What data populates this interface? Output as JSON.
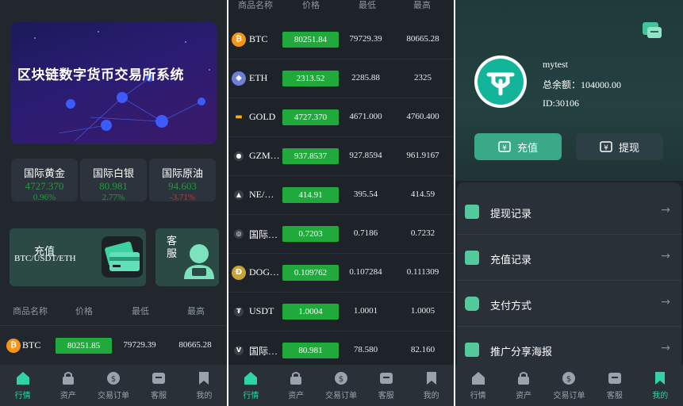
{
  "home": {
    "banner_title": "区块链数字货币交易所系统",
    "tickers": [
      {
        "name": "国际黄金",
        "value": "4727.370",
        "change": "0.96%"
      },
      {
        "name": "国际白银",
        "value": "80.981",
        "change": "2.77%"
      },
      {
        "name": "国际原油",
        "value": "94.603",
        "change": "-3.71%"
      }
    ],
    "recharge_title": "充值",
    "recharge_sub": "BTC/USDT/ETH",
    "service_label": "客服",
    "list_headers": [
      "商品名称",
      "价格",
      "最低",
      "最高"
    ],
    "first_row": {
      "icon": "bitcoin-icon",
      "name": "BTC",
      "price": "80251.85",
      "low": "79729.39",
      "high": "80665.28"
    }
  },
  "market": {
    "headers": [
      "商品名称",
      "价格",
      "最低",
      "最高"
    ],
    "rows": [
      {
        "icon": "bitcoin-icon",
        "name": "BTC",
        "price": "80251.84",
        "low": "79729.39",
        "high": "80665.28"
      },
      {
        "icon": "ethereum-icon",
        "name": "ETH",
        "price": "2313.52",
        "low": "2285.88",
        "high": "2325"
      },
      {
        "icon": "gold-bars-icon",
        "name": "GOLD",
        "price": "4727.370",
        "low": "4671.000",
        "high": "4760.400"
      },
      {
        "icon": "gzm-coin-icon",
        "name": "GZM…",
        "price": "937.8537",
        "low": "927.8594",
        "high": "961.9167"
      },
      {
        "icon": "ne-coin-icon",
        "name": "NE/…",
        "price": "414.91",
        "low": "395.54",
        "high": "414.59"
      },
      {
        "icon": "intl-coin-icon",
        "name": "国际…",
        "price": "0.7203",
        "low": "0.7186",
        "high": "0.7232"
      },
      {
        "icon": "dogecoin-icon",
        "name": "DOG…",
        "price": "0.109762",
        "low": "0.107284",
        "high": "0.111309"
      },
      {
        "icon": "usdt-icon",
        "name": "USDT",
        "price": "1.0004",
        "low": "1.0001",
        "high": "1.0005"
      },
      {
        "icon": "silver-coin-icon",
        "name": "国际…",
        "price": "80.981",
        "low": "78.580",
        "high": "82.160"
      }
    ]
  },
  "profile": {
    "username": "mytest",
    "balance": "总余额：104000.00",
    "uid": "ID:30106",
    "deposit_label": "充值",
    "withdraw_label": "提现",
    "menu": [
      {
        "icon": "withdraw-record-icon",
        "label": "提现记录"
      },
      {
        "icon": "deposit-record-icon",
        "label": "充值记录"
      },
      {
        "icon": "wallet-icon",
        "label": "支付方式"
      },
      {
        "icon": "poster-icon",
        "label": "推广分享海报"
      }
    ]
  },
  "nav": [
    "行情",
    "资产",
    "交易订单",
    "客服",
    "我的"
  ],
  "colors": {
    "accent": "#2fd3a6",
    "up_green": "#1faa3b",
    "down_red": "#c8342c"
  }
}
